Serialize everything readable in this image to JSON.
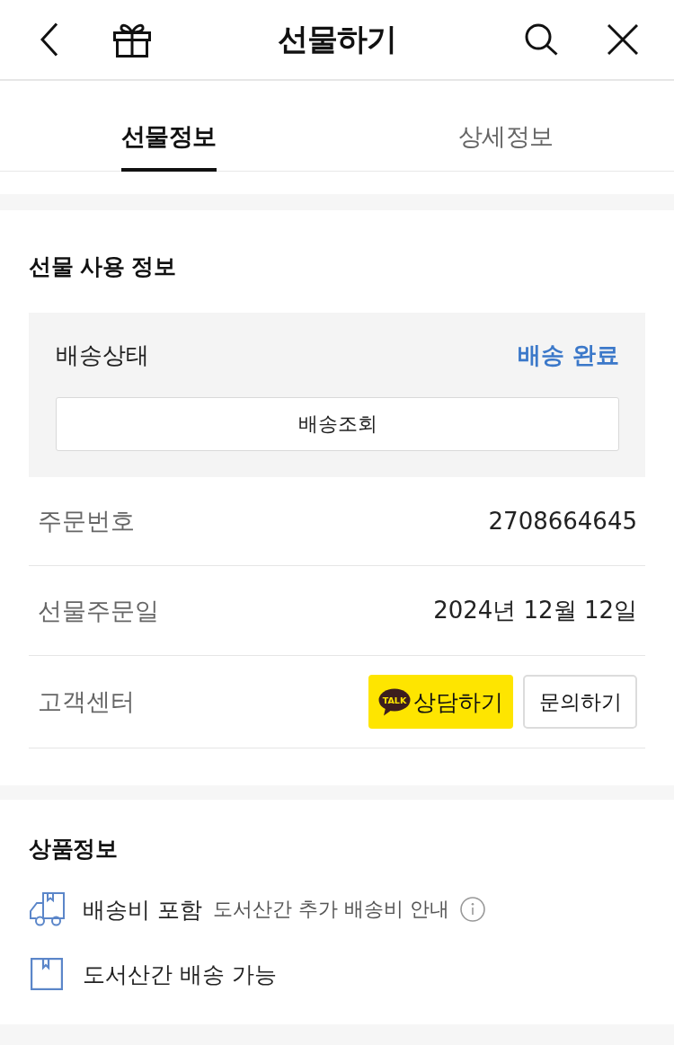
{
  "header": {
    "title": "선물하기"
  },
  "tabs": [
    {
      "label": "선물정보",
      "selected": true
    },
    {
      "label": "상세정보",
      "selected": false
    }
  ],
  "gift_usage": {
    "title": "선물 사용 정보",
    "delivery_status": {
      "label": "배송상태",
      "value": "배송 완료"
    },
    "tracking_button": "배송조회",
    "rows": [
      {
        "label": "주문번호",
        "value": "2708664645"
      },
      {
        "label": "선물주문일",
        "value": "2024년 12월 12일"
      }
    ],
    "customer_center": {
      "label": "고객센터",
      "buttons": [
        {
          "kind": "kakao",
          "logo_text": "TALK",
          "label": "상담하기"
        },
        {
          "kind": "outline",
          "label": "문의하기"
        }
      ]
    }
  },
  "product_info": {
    "title": "상품정보",
    "items": [
      {
        "kind": "truck",
        "label": "배송비 포함",
        "note": "도서산간 추가 배송비 안내"
      },
      {
        "kind": "box",
        "label": "도서산간 배송 가능"
      }
    ]
  }
}
